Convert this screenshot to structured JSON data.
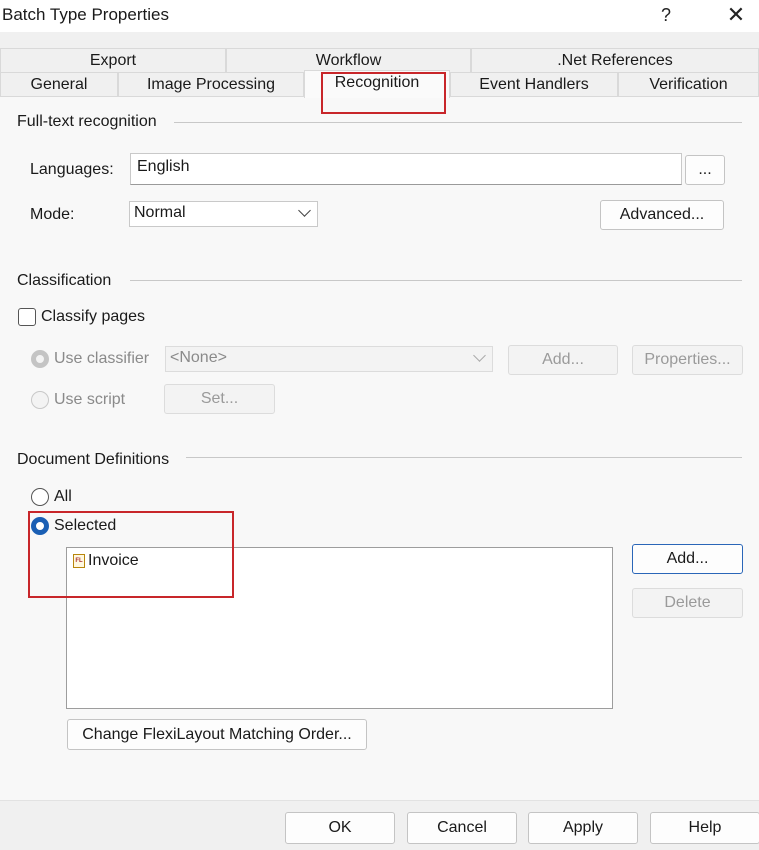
{
  "window": {
    "title": "Batch Type Properties",
    "help": "?",
    "close": "✕"
  },
  "tabs": {
    "row1": [
      {
        "label": "Export"
      },
      {
        "label": "Workflow"
      },
      {
        "label": ".Net References"
      }
    ],
    "row2": [
      {
        "label": "General"
      },
      {
        "label": "Image Processing"
      },
      {
        "label": "Recognition"
      },
      {
        "label": "Event Handlers"
      },
      {
        "label": "Verification"
      }
    ],
    "active": "Recognition"
  },
  "fulltext": {
    "group_label": "Full-text recognition",
    "languages_label": "Languages:",
    "languages_value": "English",
    "browse_label": "...",
    "mode_label": "Mode:",
    "mode_value": "Normal",
    "advanced_label": "Advanced..."
  },
  "classification": {
    "group_label": "Classification",
    "classify_pages_label": "Classify pages",
    "use_classifier_label": "Use classifier",
    "classifier_value": "<None>",
    "add_label": "Add...",
    "properties_label": "Properties...",
    "use_script_label": "Use script",
    "set_label": "Set..."
  },
  "docdefs": {
    "group_label": "Document Definitions",
    "all_label": "All",
    "selected_label": "Selected",
    "items": [
      {
        "icon": "flexilayout-doc-icon",
        "label": "Invoice"
      }
    ],
    "add_label": "Add...",
    "delete_label": "Delete",
    "change_order_label": "Change FlexiLayout Matching Order..."
  },
  "footer": {
    "ok": "OK",
    "cancel": "Cancel",
    "apply": "Apply",
    "help": "Help"
  },
  "colors": {
    "highlight": "#c8262a",
    "accent": "#1a5fb4"
  }
}
